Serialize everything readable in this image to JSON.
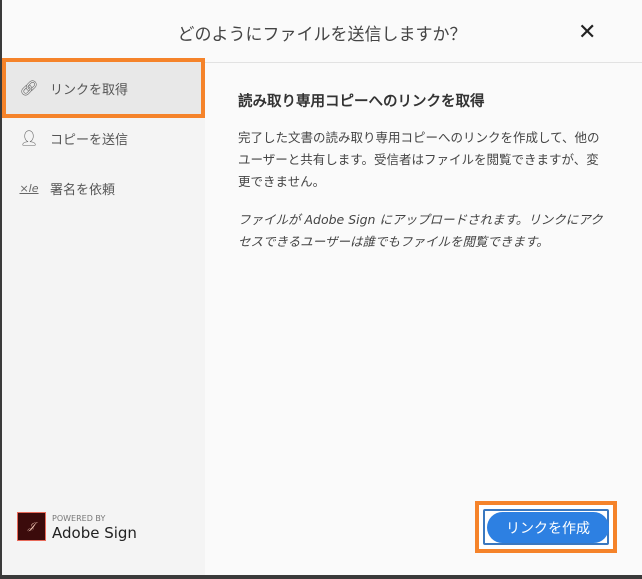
{
  "dialog": {
    "title": "どのようにファイルを送信しますか？",
    "close_icon": "close-icon"
  },
  "sidebar": {
    "items": [
      {
        "label": "リンクを取得",
        "icon": "link-icon",
        "selected": true
      },
      {
        "label": "コピーを送信",
        "icon": "user-add-icon",
        "selected": false
      },
      {
        "label": "署名を依頼",
        "icon": "signature-icon",
        "selected": false
      }
    ]
  },
  "main": {
    "heading": "読み取り専用コピーへのリンクを取得",
    "description": "完了した文書の読み取り専用コピーへのリンクを作成して、他のユーザーと共有します。受信者はファイルを閲覧できますが、変更できません。",
    "note": "ファイルが Adobe Sign にアップロードされます。リンクにアクセスできるユーザーは誰でもファイルを閲覧できます。"
  },
  "footer": {
    "powered_by": "POWERED BY",
    "brand": "Adobe Sign",
    "create_link_button": "リンクを作成"
  },
  "colors": {
    "accent": "#2d80e2",
    "highlight": "#f5832a"
  }
}
